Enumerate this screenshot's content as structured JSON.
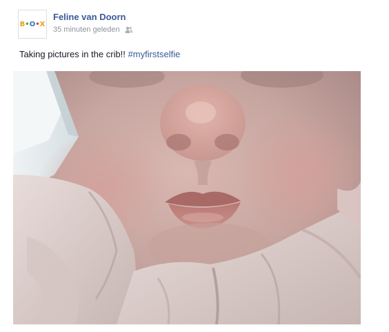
{
  "post": {
    "author": {
      "name": "Feline van Doorn",
      "avatar_letters": [
        "B",
        "•",
        "O",
        "•",
        "X"
      ]
    },
    "timestamp": "35 minuten geleden",
    "privacy_icon": "friends-icon",
    "caption": {
      "text": "Taking pictures in the crib!!",
      "hashtag": "#myfirstselfie"
    },
    "photo": {
      "subject": "baby-face-photo"
    }
  },
  "colors": {
    "link": "#3b5998",
    "meta": "#90949c",
    "text": "#141823",
    "avatar_b": "#e6a21a",
    "avatar_o": "#2f73b8",
    "avatar_dot1": "#5aa63c",
    "avatar_dot2": "#d8473a"
  }
}
